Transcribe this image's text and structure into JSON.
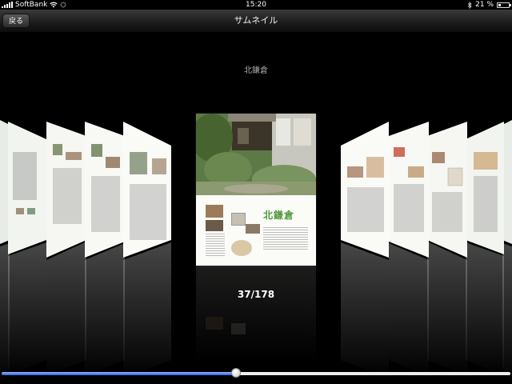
{
  "status_bar": {
    "carrier": "SoftBank",
    "time": "15:20",
    "battery": "21 %",
    "battery_level": 0.21
  },
  "nav": {
    "back_label": "戻る",
    "title": "サムネイル"
  },
  "section_title": "北鎌倉",
  "counter": "37/178",
  "progress": {
    "current": 37,
    "total": 178
  },
  "center_page": {
    "heading": "北鎌倉"
  },
  "colors": {
    "accent": "#2f63e0",
    "background": "#000000"
  }
}
